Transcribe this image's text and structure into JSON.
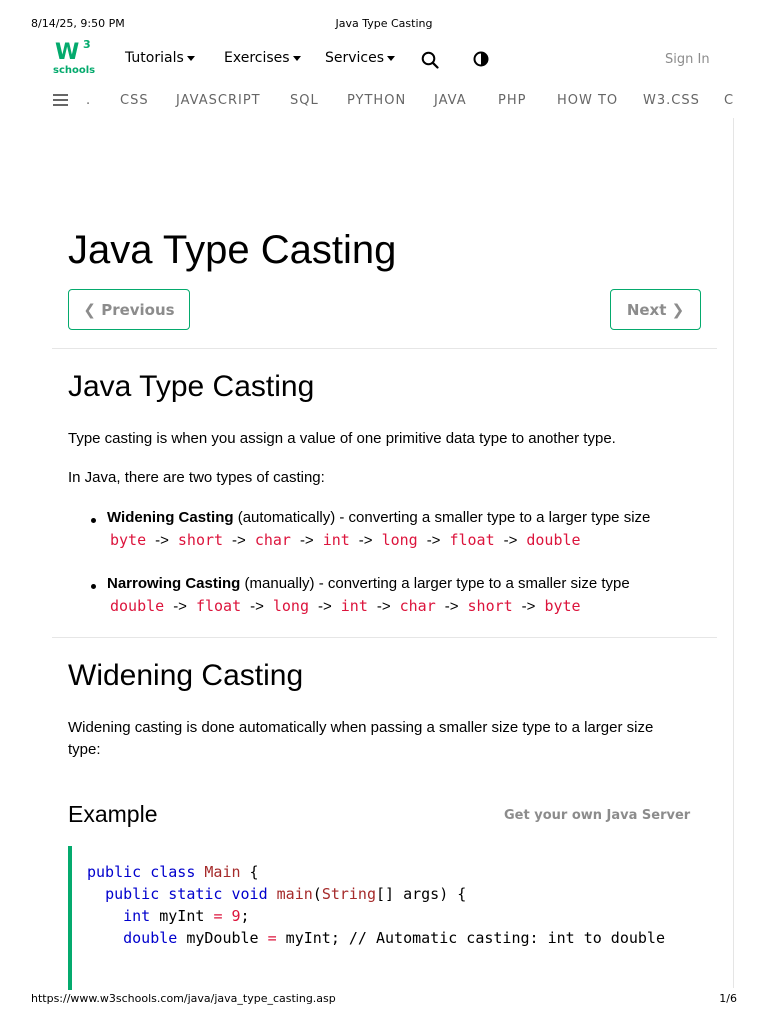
{
  "print": {
    "datetime": "8/14/25, 9:50 PM",
    "title": "Java Type Casting",
    "url": "https://www.w3schools.com/java/java_type_casting.asp",
    "page": "1/6"
  },
  "brand": {
    "logo_main": "W",
    "logo_sup": "3",
    "logo_sub": "schools",
    "color": "#04AA6D"
  },
  "nav": {
    "tutorials": "Tutorials",
    "exercises": "Exercises",
    "services": "Services",
    "sign_in": "Sign In"
  },
  "topics": [
    ".",
    "CSS",
    "JAVASCRIPT",
    "SQL",
    "PYTHON",
    "JAVA",
    "PHP",
    "HOW TO",
    "W3.CSS",
    "C"
  ],
  "main": {
    "title": "Java Type Casting",
    "prev_label": "❮ Previous",
    "next_label": "Next ❯",
    "section1": {
      "heading": "Java Type Casting",
      "p1": "Type casting is when you assign a value of one primitive data type to another type.",
      "p2": "In Java, there are two types of casting:",
      "bullets": [
        {
          "bold": "Widening Casting",
          "rest": " (automatically) - converting a smaller type to a larger type size",
          "chain": [
            "byte",
            "short",
            "char",
            "int",
            "long",
            "float",
            "double"
          ]
        },
        {
          "bold": "Narrowing Casting",
          "rest": " (manually) - converting a larger type to a smaller size type",
          "chain": [
            "double",
            "float",
            "long",
            "int",
            "char",
            "short",
            "byte"
          ]
        }
      ],
      "arrow": "->"
    },
    "section2": {
      "heading": "Widening Casting",
      "p1": "Widening casting is done automatically when passing a smaller size type to a larger size type:"
    },
    "example": {
      "heading": "Example",
      "own_server": "Get your own Java Server",
      "code": {
        "l1_kw1": "public",
        "l1_kw2": "class",
        "l1_cls": "Main",
        "l1_rest": " {",
        "l2_kw1": "public",
        "l2_kw2": "static",
        "l2_kw3": "void",
        "l2_fn": "main",
        "l2_p1": "(",
        "l2_type": "String",
        "l2_rest": "[] args) {",
        "l3_kw": "int",
        "l3_var": " myInt ",
        "l3_eq": "=",
        "l3_num": "9",
        "l3_end": ";",
        "l4_kw": "double",
        "l4_var": " myDouble ",
        "l4_eq": "=",
        "l4_rest": " myInt; // Automatic casting: int to double"
      }
    }
  }
}
